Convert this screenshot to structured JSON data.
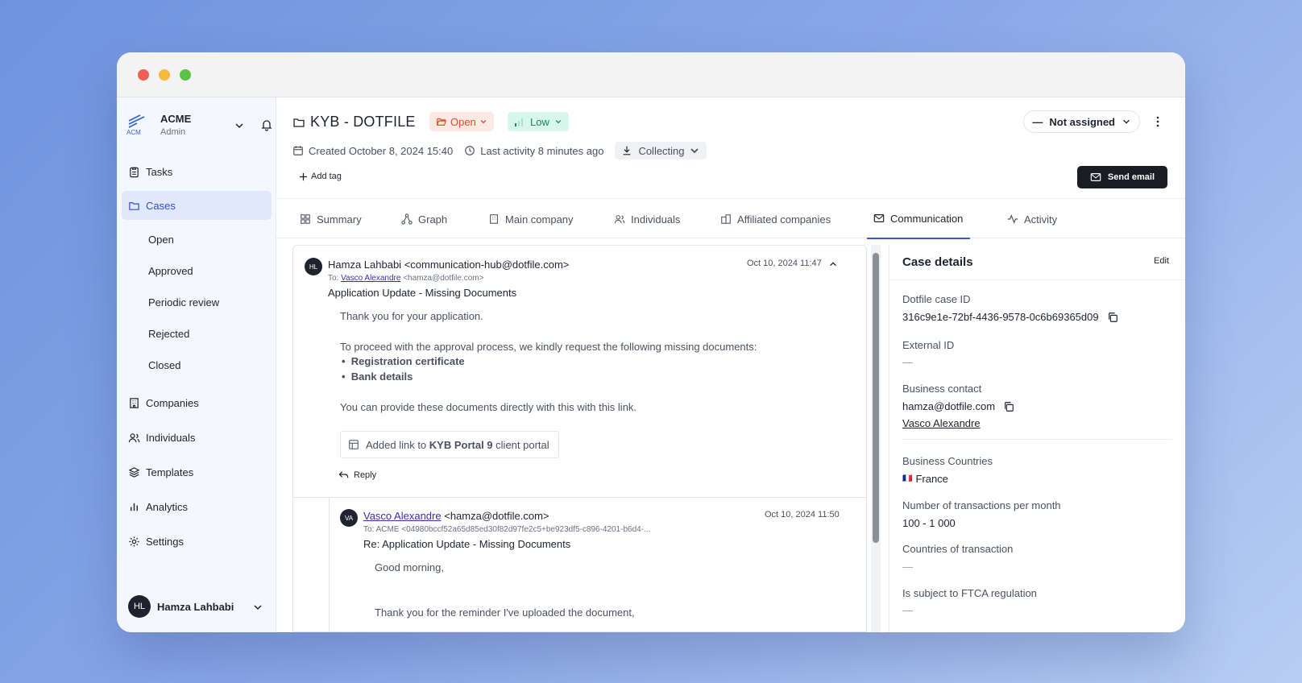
{
  "sidebar": {
    "org_name": "ACME",
    "org_role": "Admin",
    "logo_text": "ACM",
    "nav": [
      {
        "label": "Tasks",
        "icon": "clipboard-icon"
      },
      {
        "label": "Cases",
        "icon": "folder-icon"
      },
      {
        "label": "Companies",
        "icon": "building-icon"
      },
      {
        "label": "Individuals",
        "icon": "users-icon"
      },
      {
        "label": "Templates",
        "icon": "layers-icon"
      },
      {
        "label": "Analytics",
        "icon": "bar-chart-icon"
      },
      {
        "label": "Settings",
        "icon": "gear-icon"
      }
    ],
    "active_nav": "Cases",
    "cases_sub": [
      "Open",
      "Approved",
      "Periodic review",
      "Rejected",
      "Closed"
    ],
    "user": {
      "initials": "HL",
      "name": "Hamza Lahbabi"
    }
  },
  "header": {
    "title": "KYB - DOTFILE",
    "status": "Open",
    "risk": "Low",
    "assignee": "Not assigned",
    "created": "Created October 8, 2024 15:40",
    "last_activity": "Last activity 8 minutes ago",
    "stage": "Collecting",
    "add_tag": "Add tag",
    "send_email": "Send email"
  },
  "tabs": [
    {
      "label": "Summary",
      "icon": "grid-icon"
    },
    {
      "label": "Graph",
      "icon": "graph-icon"
    },
    {
      "label": "Main company",
      "icon": "building-icon"
    },
    {
      "label": "Individuals",
      "icon": "users-icon"
    },
    {
      "label": "Affiliated companies",
      "icon": "buildings-icon"
    },
    {
      "label": "Communication",
      "icon": "mail-icon"
    },
    {
      "label": "Activity",
      "icon": "activity-icon"
    }
  ],
  "active_tab": "Communication",
  "emails": [
    {
      "initials": "HL",
      "from_name": "Hamza Lahbabi",
      "from_addr": "<communication-hub@dotfile.com>",
      "to_prefix": "To:",
      "to_name": "Vasco Alexandre",
      "to_addr": "<hamza@dotfile.com>",
      "date": "Oct 10, 2024 11:47",
      "subject": "Application Update - Missing Documents",
      "body_1": "Thank you for your application.",
      "body_2": "To proceed with the approval process, we kindly request the following missing documents:",
      "list": [
        "Registration certificate",
        "Bank details"
      ],
      "body_3": "You can provide these documents directly with this with this link.",
      "link_prefix": "Added link to",
      "link_bold": "KYB Portal 9",
      "link_suffix": "client portal",
      "reply": "Reply"
    },
    {
      "initials": "VA",
      "from_name": "Vasco Alexandre",
      "from_addr": "<hamza@dotfile.com>",
      "to_line": "To: ACME <04980bccf52a65d85ed30f82d97fe2c5+be923df5-c896-4201-b6d4-...",
      "date": "Oct 10, 2024 11:50",
      "subject": "Re: Application Update - Missing Documents",
      "body_1": "Good morning,",
      "body_2": "Thank you for the reminder I've uploaded the document,"
    }
  ],
  "details": {
    "title": "Case details",
    "edit": "Edit",
    "case_id_label": "Dotfile case ID",
    "case_id": "316c9e1e-72bf-4436-9578-0c6b69365d09",
    "external_id_label": "External ID",
    "empty": "—",
    "contact_label": "Business contact",
    "contact_email": "hamza@dotfile.com",
    "contact_name": "Vasco Alexandre",
    "countries_label": "Business Countries",
    "country_flag": "🇫🇷",
    "country": "France",
    "tx_label": "Number of transactions per month",
    "tx_value": "100 - 1 000",
    "tx_countries_label": "Countries of transaction",
    "ftca_label": "Is subject to FTCA regulation"
  },
  "colors": {
    "accent": "#3a56d4",
    "open": "#e04a25",
    "low": "#1a8a5d",
    "sidebar_bg": "#f4f7fd"
  }
}
